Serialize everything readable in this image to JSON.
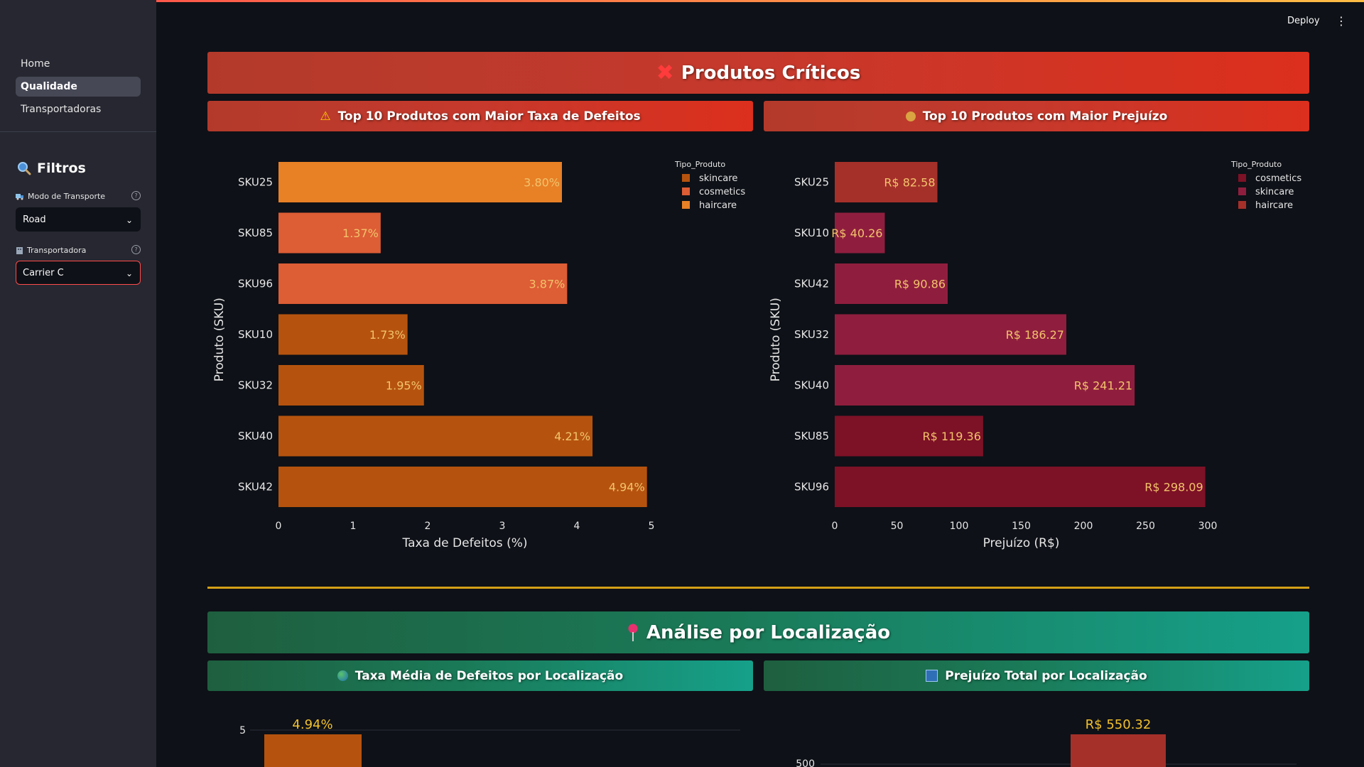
{
  "header": {
    "deploy_label": "Deploy",
    "menu_icon": "kebab-icon"
  },
  "sidebar": {
    "nav": [
      {
        "label": "Home",
        "active": false
      },
      {
        "label": "Qualidade",
        "active": true
      },
      {
        "label": "Transportadoras",
        "active": false
      }
    ],
    "filters_title": "Filtros",
    "filters": [
      {
        "label": "Modo de Transporte",
        "value": "Road",
        "icon": "truck-icon"
      },
      {
        "label": "Transportadora",
        "value": "Carrier C",
        "icon": "building-icon"
      }
    ]
  },
  "sections": {
    "critical": {
      "title": "Produtos Críticos",
      "icon": "cross-mark-icon",
      "left_title": "Top 10 Produtos com Maior Taxa de Defeitos",
      "right_title": "Top 10 Produtos com Maior Prejuízo"
    },
    "location": {
      "title": "Análise por Localização",
      "icon": "pin-icon",
      "left_title": "Taxa Média de Defeitos por Localização",
      "right_title": "Prejuízo Total por Localização"
    }
  },
  "colors": {
    "accent": "#ff4b4b",
    "divider": "#d4a017",
    "skincare_orange": "#b5530e",
    "cosmetics_orange": "#dd5d35",
    "haircare_orange": "#e88026",
    "label_gold": "#f2c36b"
  },
  "chart_data": [
    {
      "type": "bar",
      "orientation": "horizontal",
      "categories": [
        "SKU25",
        "SKU85",
        "SKU96",
        "SKU10",
        "SKU32",
        "SKU40",
        "SKU42"
      ],
      "values": [
        3.8,
        1.37,
        3.87,
        1.73,
        1.95,
        4.21,
        4.94
      ],
      "value_labels": [
        "3.80%",
        "1.37%",
        "3.87%",
        "1.73%",
        "1.95%",
        "4.21%",
        "4.94%"
      ],
      "product_type": [
        "haircare",
        "cosmetics",
        "cosmetics",
        "skincare",
        "skincare",
        "skincare",
        "skincare"
      ],
      "legend_title": "Tipo_Produto",
      "legend": [
        {
          "name": "skincare",
          "color": "#b5530e"
        },
        {
          "name": "cosmetics",
          "color": "#dd5d35"
        },
        {
          "name": "haircare",
          "color": "#e88026"
        }
      ],
      "xlabel": "Taxa de Defeitos (%)",
      "ylabel": "Produto (SKU)",
      "xlim": [
        0,
        5
      ],
      "xticks": [
        "0",
        "1",
        "2",
        "3",
        "4",
        "5"
      ],
      "grid": false,
      "legend_position": "top-right"
    },
    {
      "type": "bar",
      "orientation": "horizontal",
      "categories": [
        "SKU25",
        "SKU10",
        "SKU42",
        "SKU32",
        "SKU40",
        "SKU85",
        "SKU96"
      ],
      "values": [
        82.58,
        40.26,
        90.86,
        186.27,
        241.21,
        119.36,
        298.09
      ],
      "value_labels": [
        "R$ 82.58",
        "R$ 40.26",
        "R$ 90.86",
        "R$ 186.27",
        "R$ 241.21",
        "R$ 119.36",
        "R$ 298.09"
      ],
      "product_type": [
        "haircare",
        "skincare",
        "skincare",
        "skincare",
        "skincare",
        "cosmetics",
        "cosmetics"
      ],
      "legend_title": "Tipo_Produto",
      "legend": [
        {
          "name": "cosmetics",
          "color": "#7d1126"
        },
        {
          "name": "skincare",
          "color": "#8f1e3e"
        },
        {
          "name": "haircare",
          "color": "#a5302a"
        }
      ],
      "xlabel": "Prejuízo (R$)",
      "ylabel": "Produto (SKU)",
      "xlim": [
        0,
        300
      ],
      "xticks": [
        "0",
        "50",
        "100",
        "150",
        "200",
        "250",
        "300"
      ],
      "grid": false,
      "legend_position": "top-right"
    },
    {
      "type": "bar",
      "orientation": "vertical",
      "partially_visible": true,
      "values": [
        4.94
      ],
      "value_labels": [
        "4.94%"
      ],
      "yticks": [
        "5"
      ],
      "color": "#b5530e"
    },
    {
      "type": "bar",
      "orientation": "vertical",
      "partially_visible": true,
      "values": [
        550.32
      ],
      "value_labels": [
        "R$ 550.32"
      ],
      "yticks": [
        "500"
      ],
      "color": "#a5302a"
    }
  ]
}
